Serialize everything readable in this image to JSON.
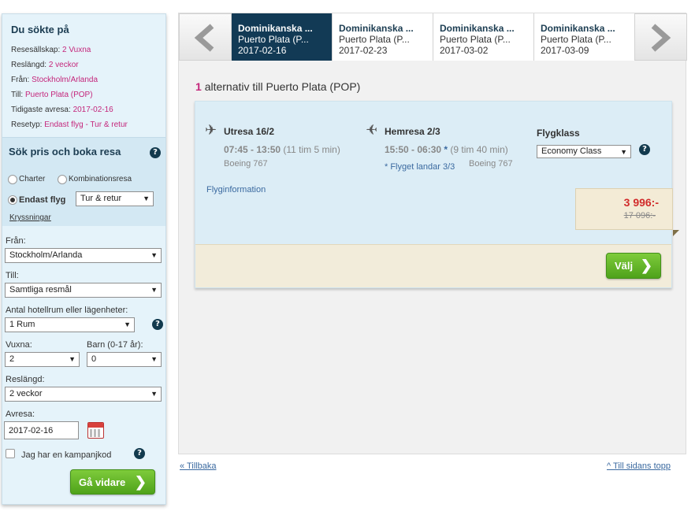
{
  "summary": {
    "title": "Du sökte på",
    "rows": [
      {
        "label": "Resesällskap:",
        "value": "2 Vuxna"
      },
      {
        "label": "Reslängd:",
        "value": "2 veckor"
      },
      {
        "label": "Från:",
        "value": "Stockholm/Arlanda"
      },
      {
        "label": "Till:",
        "value": "Puerto Plata (POP)"
      },
      {
        "label": "Tidigaste avresa:",
        "value": "2017-02-16"
      },
      {
        "label": "Resetyp:",
        "value": "Endast flyg - Tur & retur"
      }
    ]
  },
  "search": {
    "title": "Sök pris och boka resa",
    "help": "?",
    "radio_charter": "Charter",
    "radio_kombination": "Kombinationsresa",
    "radio_endast_flyg": "Endast flyg",
    "trip_type": "Tur & retur",
    "kryssningar": "Kryssningar",
    "from_label": "Från:",
    "from_value": "Stockholm/Arlanda",
    "to_label": "Till:",
    "to_value": "Samtliga resmål",
    "rooms_label": "Antal hotellrum eller lägenheter:",
    "rooms_value": "1 Rum",
    "adults_label": "Vuxna:",
    "adults_value": "2",
    "children_label": "Barn (0-17 år):",
    "children_value": "0",
    "length_label": "Reslängd:",
    "length_value": "2 veckor",
    "depart_label": "Avresa:",
    "depart_value": "2017-02-16",
    "campaign_label": "Jag har en kampanjkod",
    "submit": "Gå vidare"
  },
  "date_tabs": [
    {
      "line1": "Dominikanska ...",
      "line2": "Puerto Plata (P...",
      "date": "2017-02-16",
      "active": true
    },
    {
      "line1": "Dominikanska ...",
      "line2": "Puerto Plata (P...",
      "date": "2017-02-23",
      "active": false
    },
    {
      "line1": "Dominikanska ...",
      "line2": "Puerto Plata (P...",
      "date": "2017-03-02",
      "active": false
    },
    {
      "line1": "Dominikanska ...",
      "line2": "Puerto Plata (P...",
      "date": "2017-03-09",
      "active": false
    }
  ],
  "results": {
    "count": "1",
    "count_text": "alternativ till Puerto Plata (POP)"
  },
  "flight": {
    "outbound_title": "Utresa 16/2",
    "outbound_time": "07:45 - 13:50",
    "outbound_duration": "(11 tim 5 min)",
    "outbound_aircraft": "Boeing 767",
    "return_title": "Hemresa 2/3",
    "return_time": "15:50 - 06:30",
    "return_star": "*",
    "return_duration": "(9 tim 40 min)",
    "return_aircraft": "Boeing 767",
    "landing_note": "* Flyget landar 3/3",
    "info_link": "Flyginformation",
    "class_title": "Flygklass",
    "class_value": "Economy Class",
    "price_now": "3 996:-",
    "price_was": "17 096:-",
    "select_button": "Välj"
  },
  "footer": {
    "back": "« Tillbaka",
    "top": "^ Till sidans topp"
  },
  "colors": {
    "accent_pink": "#c4267b",
    "active_tab": "#123a55",
    "button_green": "#5cb024",
    "price_red": "#d12b2b"
  }
}
